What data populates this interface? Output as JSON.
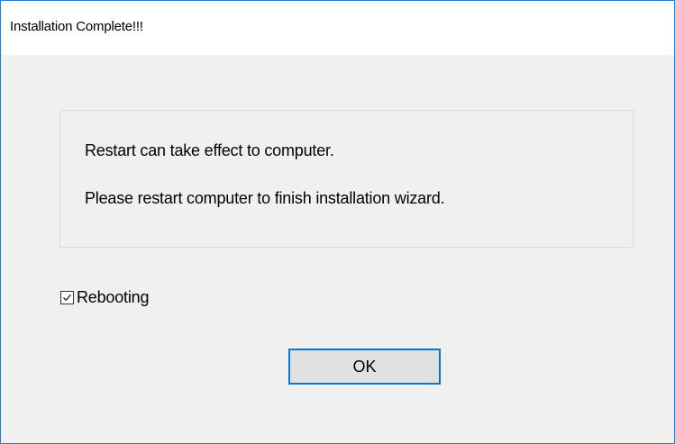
{
  "window": {
    "title": "Installation Complete!!!"
  },
  "message": {
    "line1": "Restart can take effect to computer.",
    "line2": "Please restart computer to finish installation wizard."
  },
  "reboot_option": {
    "label": "Rebooting",
    "checked": true
  },
  "buttons": {
    "ok_label": "OK"
  },
  "colors": {
    "window_border": "#1a7fd6",
    "dialog_background": "#f0f0f0",
    "titlebar_background": "#ffffff",
    "button_focus_border": "#0078d7",
    "button_face": "#e1e1e1"
  },
  "icons": {
    "checkbox_mark": "checkmark-icon"
  }
}
